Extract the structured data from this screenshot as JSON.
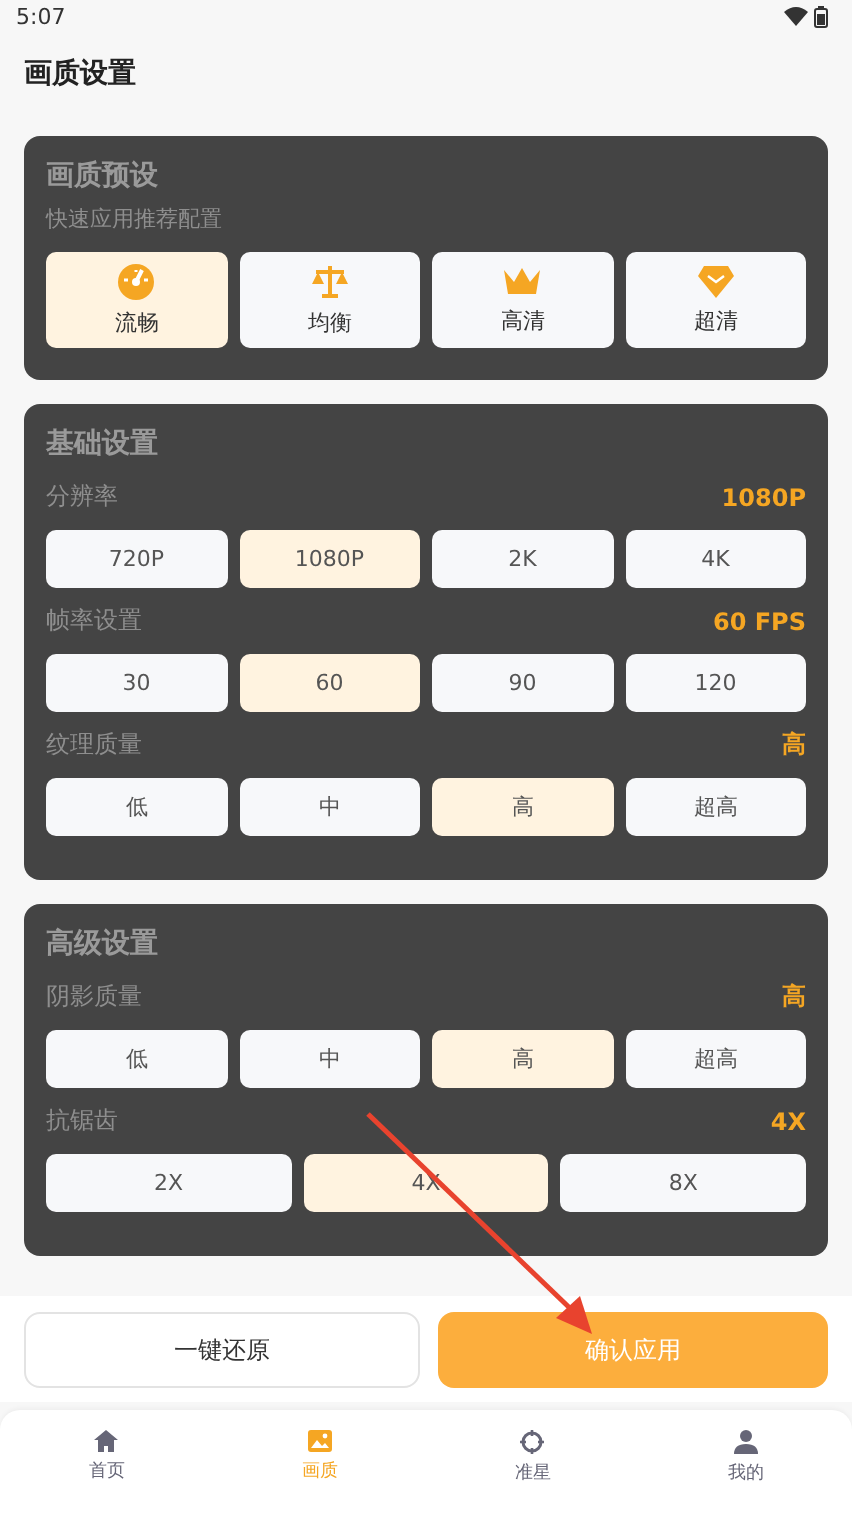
{
  "status_bar": {
    "time": "5:07"
  },
  "header": {
    "title": "画质设置"
  },
  "presets": {
    "title": "画质预设",
    "subtitle": "快速应用推荐配置",
    "items": [
      {
        "label": "流畅",
        "selected": true
      },
      {
        "label": "均衡",
        "selected": false
      },
      {
        "label": "高清",
        "selected": false
      },
      {
        "label": "超清",
        "selected": false
      }
    ]
  },
  "sections": [
    {
      "title": "基础设置",
      "settings": [
        {
          "label": "分辨率",
          "value": "1080P",
          "options": [
            {
              "label": "720P",
              "selected": false
            },
            {
              "label": "1080P",
              "selected": true
            },
            {
              "label": "2K",
              "selected": false
            },
            {
              "label": "4K",
              "selected": false
            }
          ]
        },
        {
          "label": "帧率设置",
          "value": "60 FPS",
          "options": [
            {
              "label": "30",
              "selected": false
            },
            {
              "label": "60",
              "selected": true
            },
            {
              "label": "90",
              "selected": false
            },
            {
              "label": "120",
              "selected": false
            }
          ]
        },
        {
          "label": "纹理质量",
          "value": "高",
          "options": [
            {
              "label": "低",
              "selected": false
            },
            {
              "label": "中",
              "selected": false
            },
            {
              "label": "高",
              "selected": true
            },
            {
              "label": "超高",
              "selected": false
            }
          ]
        }
      ]
    },
    {
      "title": "高级设置",
      "settings": [
        {
          "label": "阴影质量",
          "value": "高",
          "options": [
            {
              "label": "低",
              "selected": false
            },
            {
              "label": "中",
              "selected": false
            },
            {
              "label": "高",
              "selected": true
            },
            {
              "label": "超高",
              "selected": false
            }
          ]
        },
        {
          "label": "抗锯齿",
          "value": "4X",
          "options": [
            {
              "label": "2X",
              "selected": false
            },
            {
              "label": "4X",
              "selected": true
            },
            {
              "label": "8X",
              "selected": false
            }
          ]
        }
      ]
    }
  ],
  "actions": {
    "reset": "一键还原",
    "apply": "确认应用"
  },
  "nav": [
    {
      "label": "首页",
      "selected": false
    },
    {
      "label": "画质",
      "selected": true
    },
    {
      "label": "准星",
      "selected": false
    },
    {
      "label": "我的",
      "selected": false
    }
  ]
}
